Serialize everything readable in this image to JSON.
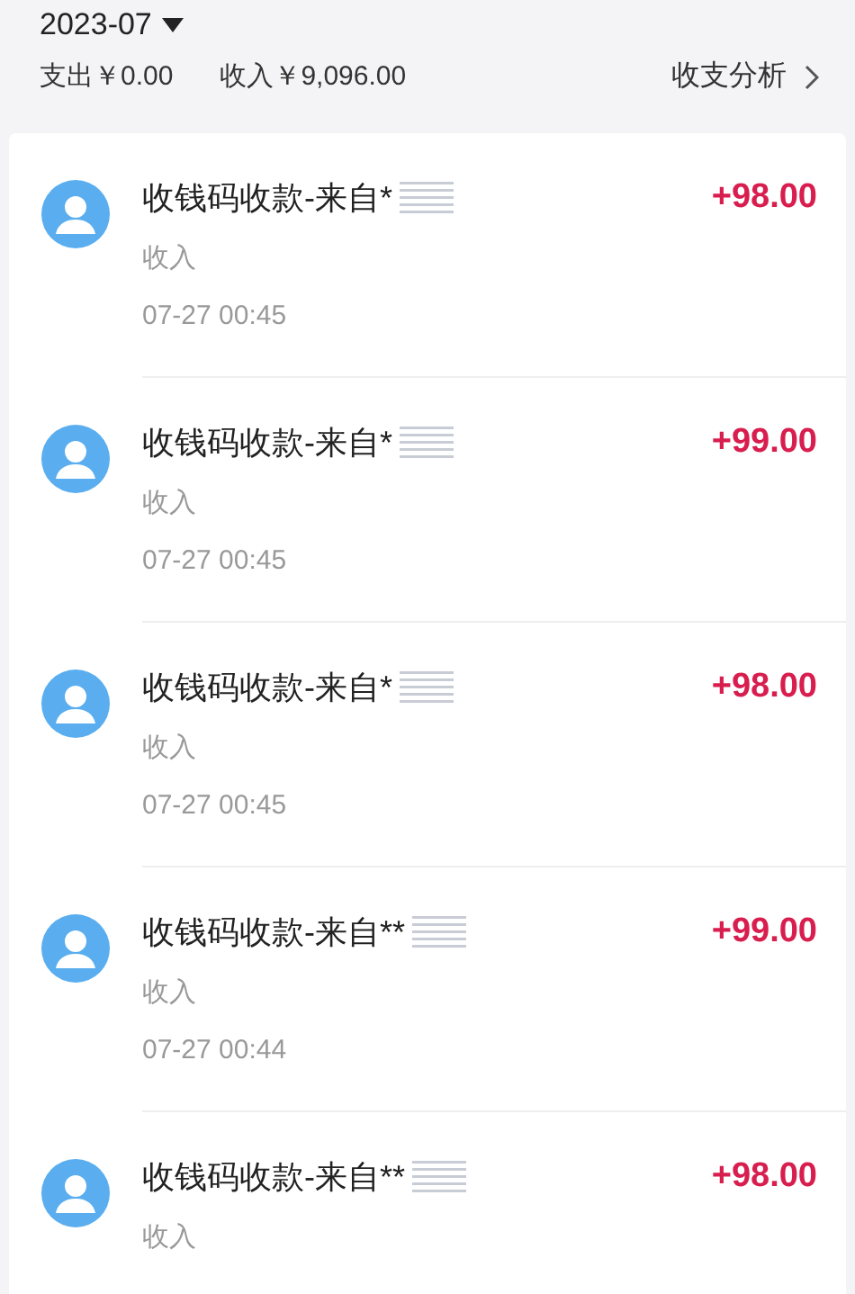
{
  "header": {
    "month": "2023-07",
    "expense": "支出￥0.00",
    "income": "收入￥9,096.00",
    "analysis_link": "收支分析"
  },
  "transactions": [
    {
      "title": "收钱码收款-来自*",
      "category": "收入",
      "time": "07-27 00:45",
      "amount": "+98.00"
    },
    {
      "title": "收钱码收款-来自*",
      "category": "收入",
      "time": "07-27 00:45",
      "amount": "+99.00"
    },
    {
      "title": "收钱码收款-来自*",
      "category": "收入",
      "time": "07-27 00:45",
      "amount": "+98.00"
    },
    {
      "title": "收钱码收款-来自**",
      "category": "收入",
      "time": "07-27 00:44",
      "amount": "+99.00"
    },
    {
      "title": "收钱码收款-来自**",
      "category": "收入",
      "amount": "+98.00"
    }
  ]
}
